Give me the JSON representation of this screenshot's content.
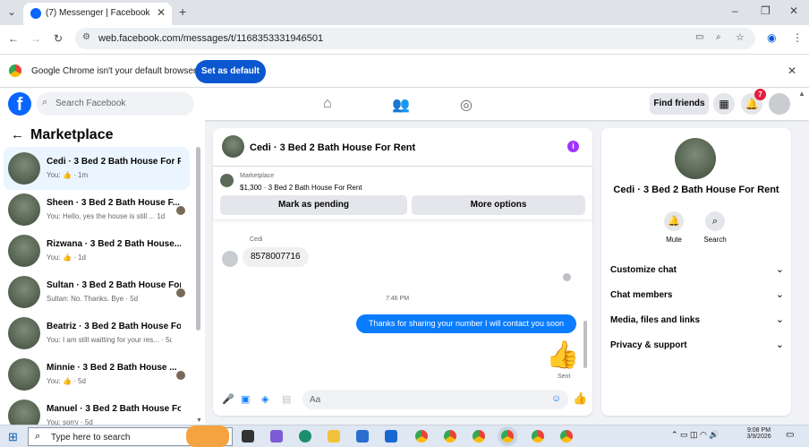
{
  "browser": {
    "tab_title": "(7) Messenger | Facebook",
    "url": "web.facebook.com/messages/t/1168353331946501",
    "infobar_text": "Google Chrome isn't your default browser",
    "infobar_button": "Set as default"
  },
  "header": {
    "search_placeholder": "Search Facebook",
    "find_friends": "Find friends",
    "notification_count": "7"
  },
  "sidebar": {
    "title": "Marketplace",
    "conversations": [
      {
        "name": "Cedi · 3 Bed 2 Bath House For R...",
        "preview": "You: 👍 · 1m"
      },
      {
        "name": "Sheen · 3 Bed 2 Bath House F...",
        "preview": "You: Hello, yes the house is still ...  1d"
      },
      {
        "name": "Rizwana · 3 Bed 2 Bath House...",
        "preview": "You: 👍 · 1d"
      },
      {
        "name": "Sultan · 3 Bed 2 Bath House For ...",
        "preview": "Sultan: No. Thanks. Bye · 5d"
      },
      {
        "name": "Beatriz · 3 Bed 2 Bath House For...",
        "preview": "You: I am still waitting for your res... · 5d"
      },
      {
        "name": "Minnie · 3 Bed 2 Bath House ...",
        "preview": "You: 👍 · 5d"
      },
      {
        "name": "Manuel · 3 Bed 2 Bath House Fo...",
        "preview": "You: sorry · 5d"
      }
    ]
  },
  "chat": {
    "title": "Cedi · 3 Bed 2 Bath House For Rent",
    "listing_label": "Marketplace",
    "listing_price": "$1,300 · 3 Bed 2 Bath House For Rent",
    "mark_pending": "Mark as pending",
    "more_options": "More options",
    "sender_name": "Cedi",
    "incoming_message": "8578007716",
    "timestamp": "7:46 PM",
    "outgoing_message": "Thanks for sharing your number I will contact you soon",
    "sent_status": "Sent",
    "composer_placeholder": "Aa"
  },
  "details": {
    "name": "Cedi · 3 Bed 2 Bath House For Rent",
    "mute": "Mute",
    "search": "Search",
    "options": [
      "Customize chat",
      "Chat members",
      "Media, files and links",
      "Privacy & support"
    ]
  },
  "taskbar": {
    "search_placeholder": "Type here to search",
    "time": "9:08 PM",
    "date": "3/9/2026"
  },
  "colors": {
    "fb_blue": "#0866ff",
    "message_blue": "#0a7cff",
    "info_purple": "#a033ff"
  }
}
